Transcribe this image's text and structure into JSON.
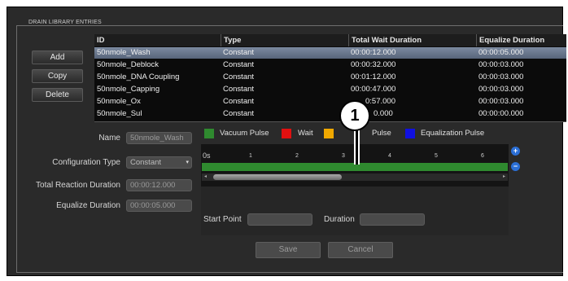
{
  "group_title": "DRAIN LIBRARY ENTRIES",
  "buttons": {
    "add": "Add",
    "copy": "Copy",
    "delete": "Delete",
    "save": "Save",
    "cancel": "Cancel"
  },
  "table": {
    "columns": [
      "ID",
      "Type",
      "Total Wait Duration",
      "Equalize Duration"
    ],
    "rows": [
      [
        "50nmole_Wash",
        "Constant",
        "00:00:12.000",
        "00:00:05.000"
      ],
      [
        "50nmole_Deblock",
        "Constant",
        "00:00:32.000",
        "00:00:03.000"
      ],
      [
        "50nmole_DNA Coupling",
        "Constant",
        "00:01:12.000",
        "00:00:03.000"
      ],
      [
        "50nmole_Capping",
        "Constant",
        "00:00:47.000",
        "00:00:03.000"
      ],
      [
        "50nmole_Ox",
        "Constant",
        "0:57.000",
        "00:00:03.000"
      ],
      [
        "50nmole_Sul",
        "Constant",
        "0.000",
        "00:00:00.000"
      ]
    ],
    "selected_row": 0
  },
  "form": {
    "name_label": "Name",
    "name_value": "50nmole_Wash",
    "config_label": "Configuration Type",
    "config_value": "Constant",
    "total_label": "Total Reaction Duration",
    "total_value": "00:00:12.000",
    "equalize_label": "Equalize Duration",
    "equalize_value": "00:00:05.000",
    "start_label": "Start Point",
    "start_value": "",
    "duration_label": "Duration",
    "duration_value": ""
  },
  "legend": [
    {
      "label": "Vacuum Pulse",
      "color": "#2f8a2f"
    },
    {
      "label": "Wait",
      "color": "#e01010"
    },
    {
      "label": "Pulse",
      "color": "#f0a800"
    },
    {
      "label": "Equalization Pulse",
      "color": "#1010e0"
    }
  ],
  "timeline_ticks": [
    "0s",
    "1",
    "2",
    "3",
    "4",
    "5",
    "6"
  ],
  "zoom": {
    "in_icon": "zoom-in-icon",
    "out_icon": "zoom-out-icon"
  },
  "callout_number": "1"
}
